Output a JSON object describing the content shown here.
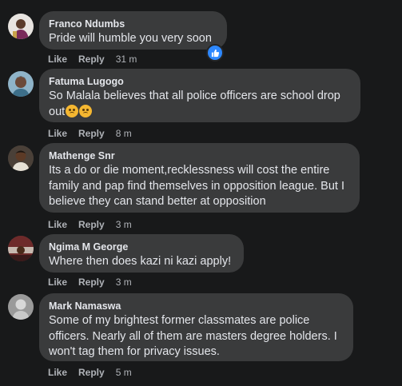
{
  "top_actions": {
    "text": "· ·"
  },
  "comments": [
    {
      "author": "Franco Ndumbs",
      "text": "Pride will humble you very soon",
      "like": "Like",
      "reply": "Reply",
      "time": "31 m",
      "has_reaction": true,
      "reaction_icon": "like-icon"
    },
    {
      "author": "Fatuma Lugogo",
      "text": "So Malala believes that all police officers are school drop out",
      "emoji": [
        "worried-face-emoji",
        "worried-face-emoji"
      ],
      "like": "Like",
      "reply": "Reply",
      "time": "8 m"
    },
    {
      "author": "Mathenge Snr",
      "text": "Its a do or die moment,recklessness will cost the entire family and pap find themselves in opposition league. But I believe they can stand better at opposition",
      "like": "Like",
      "reply": "Reply",
      "time": "3 m"
    },
    {
      "author": "Ngima M George",
      "text": "Where then does kazi ni kazi apply!",
      "like": "Like",
      "reply": "Reply",
      "time": "3 m"
    },
    {
      "author": "Mark Namaswa",
      "text": "Some of my brightest former classmates are police officers. Nearly all of them are masters degree holders. I won't tag them for privacy issues.",
      "like": "Like",
      "reply": "Reply",
      "time": "5 m"
    }
  ],
  "colors": {
    "background": "#18191a",
    "bubble": "#3a3b3c",
    "text": "#e4e6eb",
    "secondary": "#b0b3b8",
    "like_blue": "#2d88ff"
  }
}
